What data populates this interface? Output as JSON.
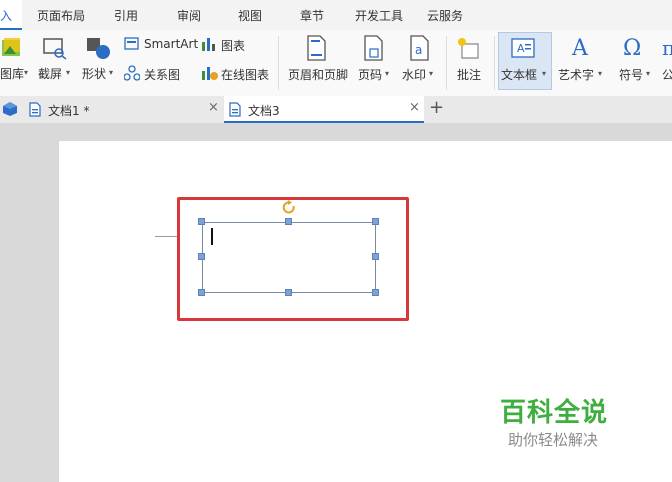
{
  "menu": {
    "tabs": [
      "入",
      "页面布局",
      "引用",
      "审阅",
      "视图",
      "章节",
      "开发工具",
      "云服务"
    ]
  },
  "ribbon": {
    "gallery_label": "图库",
    "screenshot_label": "截屏",
    "shapes_label": "形状",
    "smartart_label": "SmartArt",
    "relation_label": "关系图",
    "chart_label": "图表",
    "online_chart_label": "在线图表",
    "header_footer_label": "页眉和页脚",
    "page_number_label": "页码",
    "watermark_label": "水印",
    "comment_label": "批注",
    "textbox_label": "文本框",
    "wordart_label": "艺术字",
    "symbol_label": "符号",
    "formula_label": "公",
    "dropdown_arrow": "▾"
  },
  "doc_tabs": [
    {
      "label": "文档1 *",
      "active": false
    },
    {
      "label": "文档3",
      "active": true
    }
  ],
  "doc_tab_close": "×",
  "new_tab": "+",
  "watermark": {
    "title": "百科全说",
    "subtitle": "助你轻松解决"
  },
  "colors": {
    "accent": "#2b6cc4",
    "highlight_box": "#d9383a",
    "watermark_green": "#3fae3f",
    "handle": "#7da3d6",
    "rotate_handle": "#e8a020"
  }
}
